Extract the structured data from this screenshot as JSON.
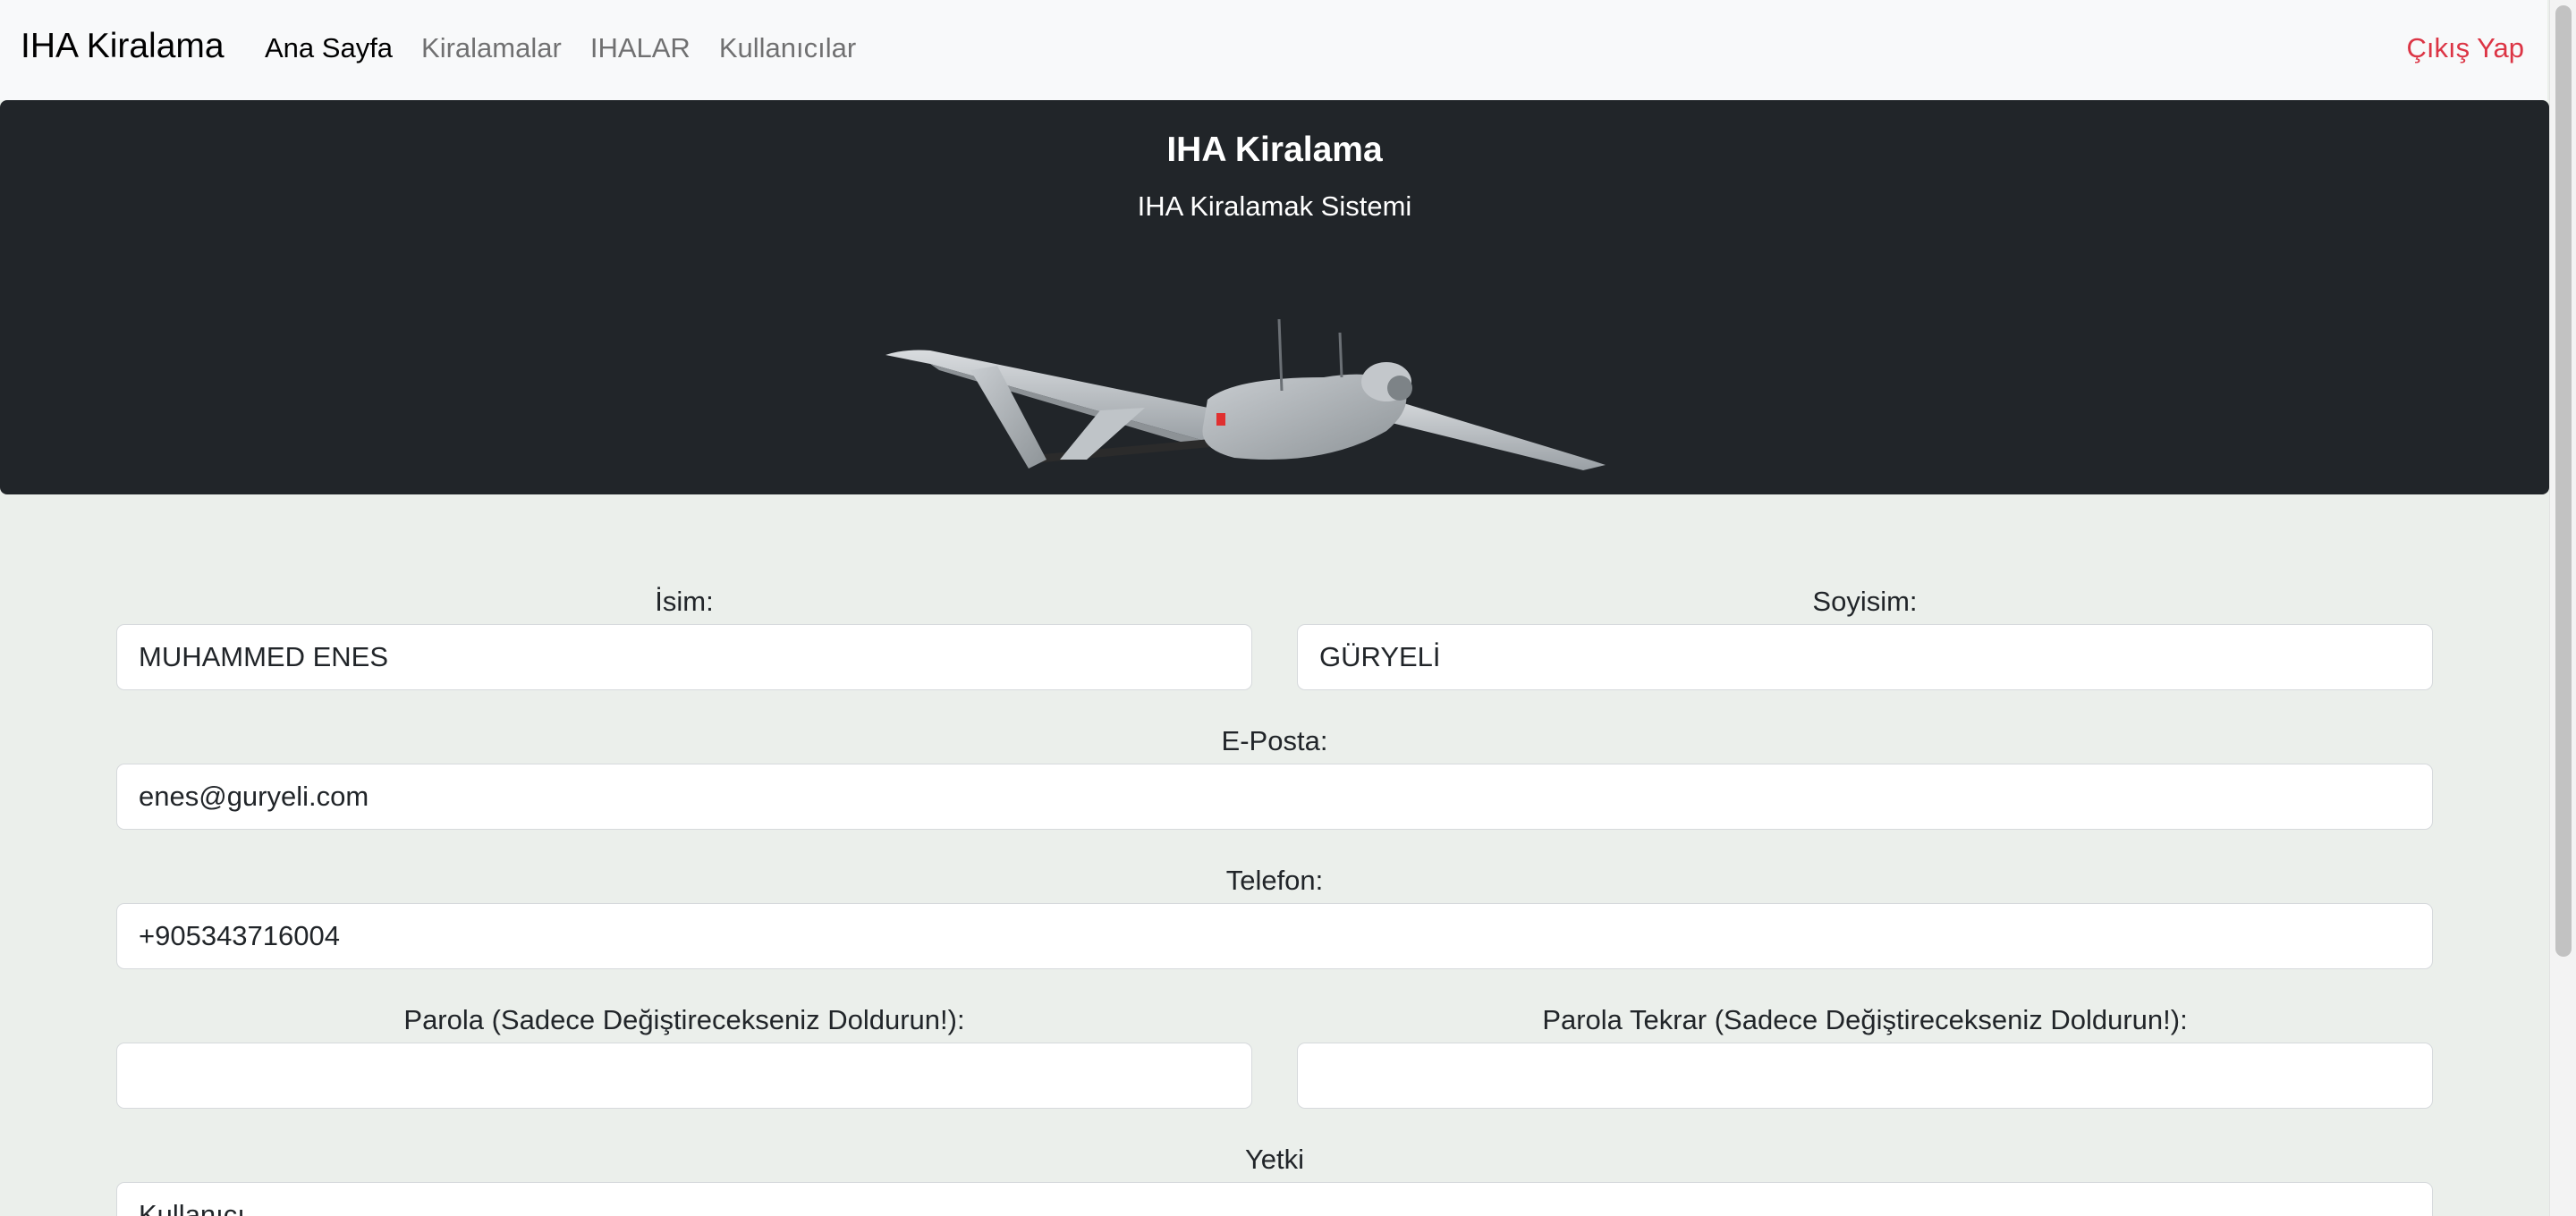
{
  "navbar": {
    "brand": "IHA Kiralama",
    "links": [
      "Ana Sayfa",
      "Kiralamalar",
      "IHALAR",
      "Kullanıcılar"
    ],
    "logout": "Çıkış Yap"
  },
  "hero": {
    "title": "IHA Kiralama",
    "subtitle": "IHA Kiralamak Sistemi"
  },
  "form": {
    "first_name_label": "İsim:",
    "first_name_value": "MUHAMMED ENES",
    "last_name_label": "Soyisim:",
    "last_name_value": "GÜRYELİ",
    "email_label": "E-Posta:",
    "email_value": "enes@guryeli.com",
    "phone_label": "Telefon:",
    "phone_value": "+905343716004",
    "password_label": "Parola (Sadece Değiştirecekseniz Doldurun!):",
    "password_value": "",
    "password_repeat_label": "Parola Tekrar (Sadece Değiştirecekseniz Doldurun!):",
    "password_repeat_value": "",
    "role_label": "Yetki",
    "role_value": "Kullanıcı"
  },
  "colors": {
    "logout": "#dc3545",
    "hero_bg": "#212529",
    "page_bg": "#ebefeb"
  }
}
